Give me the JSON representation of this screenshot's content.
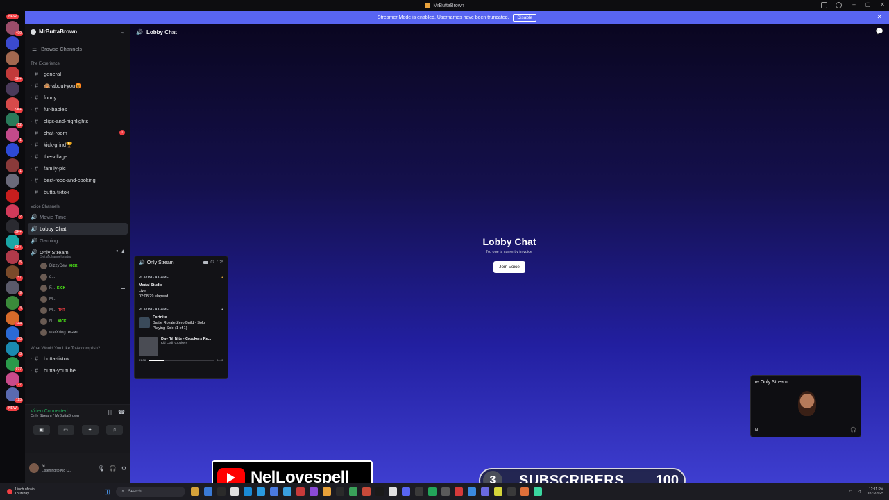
{
  "window": {
    "title": "MrButtaBrown"
  },
  "banner": {
    "text": "Streamer Mode is enabled. Usernames have been truncated.",
    "button": "Disable"
  },
  "rail": {
    "top_badge": "NEW",
    "servers": [
      {
        "color": "#9b4d6a",
        "badge": "499"
      },
      {
        "color": "#3b4acf",
        "badge": ""
      },
      {
        "color": "#a2684f",
        "badge": ""
      },
      {
        "color": "#c23a3a",
        "badge": "9K+"
      },
      {
        "color": "#4a3a5a",
        "badge": ""
      },
      {
        "color": "#d64a4a",
        "badge": "9K+"
      },
      {
        "color": "#2a7a5a",
        "badge": "12"
      },
      {
        "color": "#c24a8a",
        "badge": "1"
      },
      {
        "color": "#2d4ad6",
        "badge": ""
      },
      {
        "color": "#8a3a3a",
        "badge": "1"
      },
      {
        "color": "#6a6a7a",
        "badge": ""
      },
      {
        "color": "#c81e1e",
        "badge": ""
      },
      {
        "color": "#d23a5a",
        "badge": "2"
      },
      {
        "color": "#2a2a30",
        "badge": "9K+"
      },
      {
        "color": "#1aa6a6",
        "badge": "9K+"
      },
      {
        "color": "#b03a4a",
        "badge": "5"
      },
      {
        "color": "#7a4a2a",
        "badge": "51"
      },
      {
        "color": "#5a5a6a",
        "badge": "9"
      },
      {
        "color": "#3a8a3a",
        "badge": "4"
      },
      {
        "color": "#d66a2a",
        "badge": "144"
      },
      {
        "color": "#2a6ad6",
        "badge": "38"
      },
      {
        "color": "#1a8ab0",
        "badge": "3"
      },
      {
        "color": "#2a9a4a",
        "badge": "977"
      },
      {
        "color": "#c84a8a",
        "badge": "27"
      },
      {
        "color": "#5a6ab0",
        "badge": "113"
      }
    ],
    "bottom_badge": "NEW"
  },
  "sidebar": {
    "server_name": "MrButtaBrown",
    "browse": "Browse Channels",
    "categories": [
      {
        "name": "The Experience",
        "channels": [
          {
            "name": "general",
            "unread": ""
          },
          {
            "name": "🙈-about-you😡",
            "unread": ""
          },
          {
            "name": "funny",
            "unread": ""
          },
          {
            "name": "fur-babies",
            "unread": ""
          },
          {
            "name": "clips-and-highlights",
            "unread": ""
          },
          {
            "name": "chat-room",
            "unread": "1"
          },
          {
            "name": "kick-grind🏆",
            "unread": ""
          },
          {
            "name": "the-village",
            "unread": ""
          },
          {
            "name": "family-pic",
            "unread": ""
          },
          {
            "name": "best-food-and-cooking",
            "unread": ""
          },
          {
            "name": "butta-tiktok",
            "unread": ""
          }
        ]
      }
    ],
    "voice_category": "Voice Channels",
    "voice_channels": [
      "Movie Time",
      "Lobby Chat",
      "Gaming",
      "Only Stream"
    ],
    "set_channel": "Set a channel status",
    "voice_users": [
      {
        "name": "DizzyDev",
        "tag": "KICK",
        "tag_type": "kick",
        "cam": false
      },
      {
        "name": "d...",
        "tag": "",
        "tag_type": "",
        "cam": false
      },
      {
        "name": "F...",
        "tag": "KICK",
        "tag_type": "kick",
        "cam": true
      },
      {
        "name": "M...",
        "tag": "",
        "tag_type": "",
        "cam": false
      },
      {
        "name": "M...",
        "tag": "TNT",
        "tag_type": "tnt",
        "cam": false
      },
      {
        "name": "N...",
        "tag": "KICK",
        "tag_type": "kick",
        "cam": false
      },
      {
        "name": "warXdog",
        "tag": "RGMT",
        "tag_type": "",
        "cam": false
      }
    ],
    "category2": "What Would You Like To Accomplish?",
    "channels2": [
      "butta-tiktok",
      "butta-youtube"
    ],
    "connection": {
      "status": "Video Connected",
      "sub": "Only Stream / MrButtaBrown"
    },
    "user": {
      "name": "N...",
      "activity": "Listening to Kid C..."
    }
  },
  "stage": {
    "header": "Lobby Chat",
    "title": "Lobby Chat",
    "subtitle": "No one is currently in voice",
    "join_label": "Join Voice"
  },
  "popout": {
    "channel": "Only Stream",
    "count": "07",
    "limit": "25",
    "section1": "PLAYING A GAME",
    "game1_title": "Medal Studio",
    "game1_line2": "Live",
    "game1_line3": "02:08:29 elapsed",
    "section2": "PLAYING A GAME",
    "game2_title": "Fortnite",
    "game2_line2": "Battle Royale Zero Build - Solo",
    "game2_line3": "Playing Solo (1 of 1)",
    "music_title": "Day 'N' Nite - Crookers Re...",
    "music_artist": "Kid Cudi, Crookers",
    "music_elapsed": "01:08",
    "music_total": "04:41",
    "music_progress": 0.24
  },
  "tile": {
    "label": "Only Stream",
    "user": "N..."
  },
  "overlay": {
    "youtube_name": "NelLovespell",
    "subs_current": "3",
    "subs_label": "SUBSCRIBERS",
    "subs_goal": "100"
  },
  "taskbar": {
    "weather_line1": "1 inch of rain",
    "weather_line2": "Thursday",
    "search": "Search",
    "time": "12:11 PM",
    "date": "10/23/2025",
    "apps": [
      "#d6a23a",
      "#3a7ad6",
      "#2a2a2a",
      "#e0e0e0",
      "#1a8ad6",
      "#2a9ae0",
      "#4a7ae0",
      "#3aa0e0",
      "#c83a3a",
      "#8a4ad6",
      "#e8a23a",
      "#2a2a2a",
      "#3aa05a",
      "#c84a3a",
      "#1a1a1a",
      "#e0e0e0",
      "#5865f2",
      "#3a3a3a",
      "#23a55a",
      "#5a5a5a",
      "#d63a3a",
      "#3a8ae0",
      "#6a6ae0",
      "#d6d63a",
      "#3a3a3a",
      "#e0703a",
      "#3ad6a0"
    ]
  }
}
